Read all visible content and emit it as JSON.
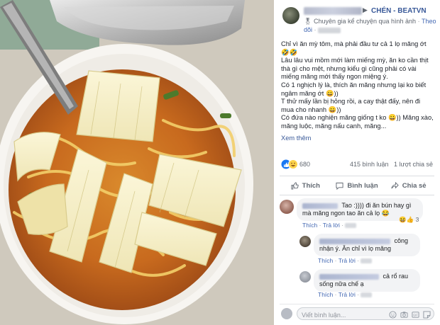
{
  "post": {
    "page_name": "CHÉN - BEATVN",
    "expert_label": "Chuyên gia kể chuyện qua hình ảnh",
    "follow_label": "Theo dõi",
    "text": "Chỉ vì ăn mỳ tôm, mà phải đầu tư cả 1 lọ măng ớt 🤣🤣\nLâu lâu vui mồm mới làm miếng mỳ, ăn ko cần thịt thà gì cho mệt, nhưng kiểu gì cũng phải có vài miếng măng mới thấy ngon miệng ý.\nCó 1 nghịch lý là, thích ăn măng nhưng lại ko biết ngâm măng ớt 😀))\nT thử mấy lần bị hỏng rồi, a cay thật đấy, nên đi mua cho nhanh 😀))\nCó đứa nào nghiện măng giống t ko 😀)) Măng xào, măng luộc, măng nấu canh, măng...",
    "see_more": "Xem thêm",
    "reaction_count": "680",
    "comment_count": "415 bình luận",
    "share_count": "1 lượt chia sẻ"
  },
  "actions": {
    "like": "Thích",
    "comment": "Bình luận",
    "share": "Chia sẻ"
  },
  "comments": [
    {
      "text": "Tao :)))) đi ăn bún hay gì mà măng ngon tao ăn cả lọ 😂",
      "like": "Thích",
      "reply": "Trả lời",
      "reaction_count": "3"
    },
    {
      "text": "công nhận ý. Ăn chỉ vì lọ măng",
      "like": "Thích",
      "reply": "Trả lời"
    },
    {
      "text": "cả rổ rau sống nữa chế ạ",
      "like": "Thích",
      "reply": "Trả lời"
    }
  ],
  "composer": {
    "placeholder": "Viết bình luận..."
  },
  "colors": {
    "link": "#385898",
    "action_link": "#4267b2",
    "bubble": "#f2f3f5",
    "secondary_text": "#616770"
  }
}
